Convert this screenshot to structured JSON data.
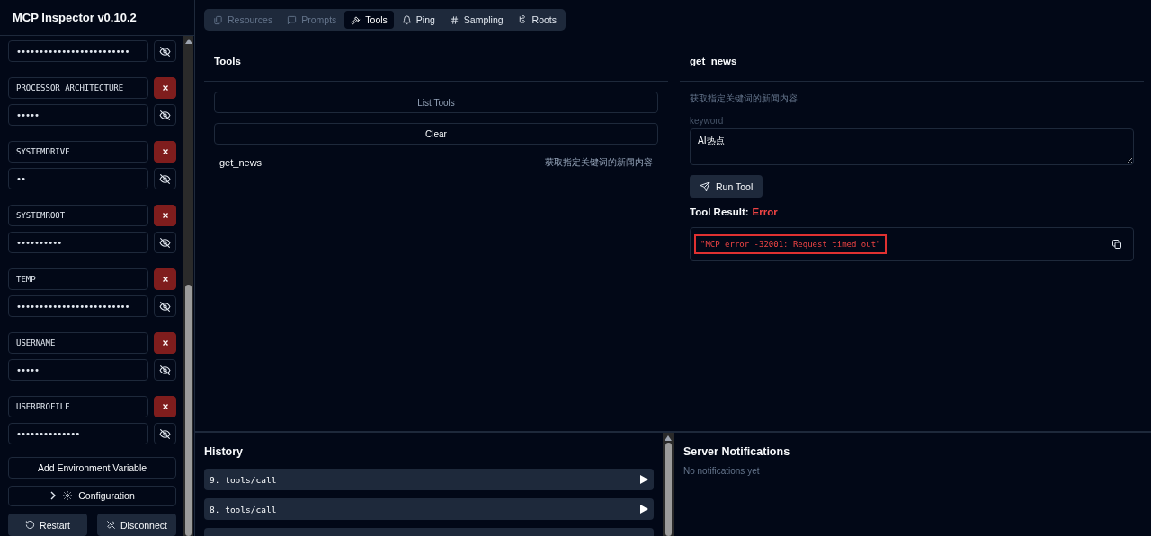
{
  "sidebar": {
    "title": "MCP Inspector v0.10.2",
    "env_vars": [
      {
        "value": "•••••••••••••••••••••••••"
      },
      {
        "key": "PROCESSOR_ARCHITECTURE",
        "value": "•••••"
      },
      {
        "key": "SYSTEMDRIVE",
        "value": "••"
      },
      {
        "key": "SYSTEMROOT",
        "value": "••••••••••"
      },
      {
        "key": "TEMP",
        "value": "•••••••••••••••••••••••••"
      },
      {
        "key": "USERNAME",
        "value": "•••••"
      },
      {
        "key": "USERPROFILE",
        "value": "••••••••••••••"
      }
    ],
    "add_button": "Add Environment Variable",
    "configuration": {
      "label": "Configuration",
      "expanded": false
    },
    "actions": [
      {
        "label": "Restart",
        "kind": "restart"
      },
      {
        "label": "Disconnect",
        "kind": "disconnect"
      }
    ]
  },
  "tabs": [
    {
      "label": "Resources",
      "kind": "resources",
      "selected": false,
      "disabled": true
    },
    {
      "label": "Prompts",
      "kind": "prompts",
      "selected": false,
      "disabled": true
    },
    {
      "label": "Tools",
      "kind": "tools",
      "selected": true,
      "disabled": false
    },
    {
      "label": "Ping",
      "kind": "ping",
      "selected": false,
      "disabled": false
    },
    {
      "label": "Sampling",
      "kind": "sampling",
      "selected": false,
      "disabled": false
    },
    {
      "label": "Roots",
      "kind": "roots",
      "selected": false,
      "disabled": false
    }
  ],
  "tools_panel": {
    "title": "Tools",
    "list_button": {
      "label": "List Tools",
      "disabled": true
    },
    "clear_button": "Clear",
    "tools": [
      {
        "name": "get_news",
        "description": "获取指定关键词的新闻内容"
      }
    ]
  },
  "tool_detail": {
    "title": "get_news",
    "description": "获取指定关键词的新闻内容",
    "params": [
      {
        "label": "keyword",
        "value": "AI热点"
      }
    ],
    "run_button": "Run Tool",
    "result_label": "Tool Result:",
    "result_status": "Error",
    "result_text": "\"MCP error -32001: Request timed out\""
  },
  "history": {
    "title": "History",
    "items": [
      {
        "label": "9. tools/call",
        "expanded": false
      },
      {
        "label": "8. tools/call",
        "expanded": false
      }
    ]
  },
  "notifications": {
    "title": "Server Notifications",
    "empty_text": "No notifications yet"
  }
}
